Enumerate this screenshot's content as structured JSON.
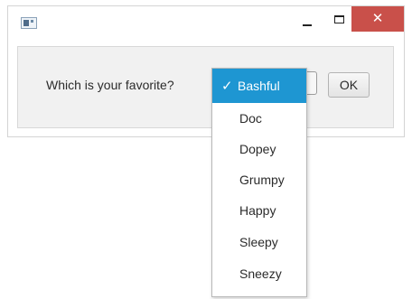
{
  "window": {
    "close_glyph": "✕",
    "accent_close": "#c9504a"
  },
  "dialog": {
    "prompt": "Which is your favorite?",
    "ok_label": "OK"
  },
  "dropdown": {
    "selected_index": 0,
    "selected_mark": "✓",
    "options": [
      "Bashful",
      "Doc",
      "Dopey",
      "Grumpy",
      "Happy",
      "Sleepy",
      "Sneezy"
    ],
    "selection_color": "#1e96d2"
  }
}
